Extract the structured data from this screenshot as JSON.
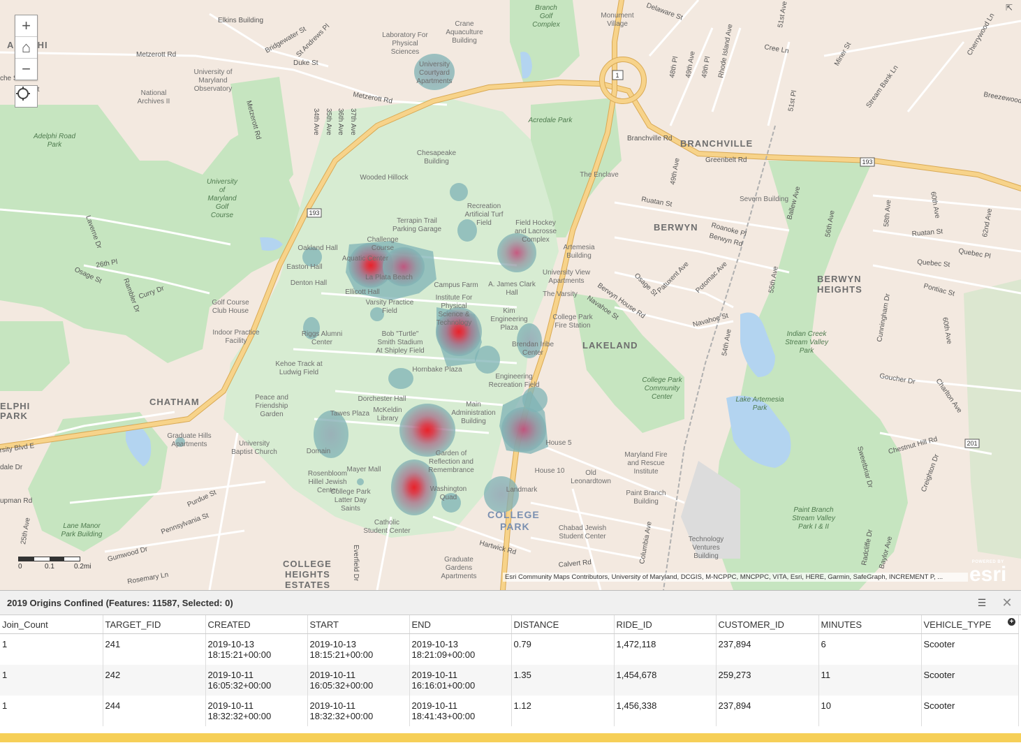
{
  "map": {
    "place_labels": {
      "adelphi_top": "ADELPHI",
      "adelphi_park": "DELPHI\nPARK",
      "chatham": "CHATHAM",
      "berwyn": "BERWYN",
      "branchville": "BRANCHVILLE",
      "lakeland": "LAKELAND",
      "berwyn_heights": "BERWYN\nHEIGHTS",
      "college_park": "COLLEGE\nPARK",
      "college_heights_estates": "COLLEGE\nHEIGHTS\nESTATES"
    },
    "road_labels": [
      "Metzerott Rd",
      "Metzerott Rd",
      "Elkins Building",
      "Bridgewater St",
      "St Andrews Pl",
      "Duke St",
      "34th Ave",
      "35th Ave",
      "36th Ave",
      "37th Ave",
      "Branchville Rd",
      "Greenbelt Rd",
      "Ruatan St",
      "Roanoke Pl",
      "Berwyn Rd",
      "Osage St",
      "Patuxent Ave",
      "Potomac Ave",
      "Navahoe St",
      "Berwyn House Rd",
      "Pontiac St",
      "Quebec St",
      "Quebec Pl",
      "Ruatan St",
      "Delaware St",
      "Cree Ln",
      "Miner St",
      "Stream Bank Ln",
      "Breezewood",
      "Cherrywood Ln",
      "Rhode Island Ave",
      "48th Pl",
      "49th Ave",
      "49th Pl",
      "51st Pl",
      "51st Ave",
      "Laverne Dr",
      "26th Pl",
      "Osage St",
      "Curry Dr",
      "Rambler Dr",
      "University Blvd E",
      "Purdue St",
      "Pennsylvania St",
      "Gumwood Dr",
      "Rosemary Ln",
      "Hartwick Rd",
      "Calvert Rd",
      "Columbia Ave",
      "Goucher Dr",
      "Chestnut Hill Rd",
      "Charlton Ave",
      "Creighton Dr",
      "Sweetbriar Dr",
      "Radcliffe Dr",
      "Baylor Ave",
      "Cunningham Dr",
      "60th Ave",
      "62nd Ave",
      "58th Ave",
      "54th Ave",
      "55th Ave",
      "56th Ave",
      "Ballew Ave",
      "Everfield Dr",
      "25th Ave",
      "Lupman Rd",
      "Adale Dr",
      "Vale Dr"
    ],
    "poi_labels": [
      "University of Maryland Observatory",
      "National Archives II",
      "Laboratory For Physical Sciences",
      "Crane Aquaculture Building",
      "University Courtyard Apartments",
      "Chesapeake Building",
      "Wooded Hillock",
      "Recreation Artificial Turf Field",
      "Terrapin Trail Parking Garage",
      "Field Hockey and Lacrosse Complex",
      "Challenge Course",
      "Aquatic Center",
      "La Plata Beach",
      "Oakland Hall",
      "Easton Hall",
      "Denton Hall",
      "Ellicott Hall",
      "Campus Farm",
      "A. James Clark Hall",
      "Institute For Physical Science & Technology",
      "Varsity Practice Field",
      "Kim Engineering Plaza",
      "Riggs Alumni Center",
      "Bob \"Turtle\" Smith Stadium At Shipley Field",
      "Brendan Iribe Center",
      "Kehoe Track at Ludwig Field",
      "Hornbake Plaza",
      "Engineering Recreation Field",
      "Dorchester Hall",
      "McKeldin Library",
      "Tawes Plaza",
      "Main Administration Building",
      "Peace and Friendship Garden",
      "Graduate Hills Apartments",
      "University Baptist Church",
      "Domain",
      "Garden of Reflection and Remembrance",
      "Mayer Mall",
      "Rosenbloom Hillel Jewish Center",
      "College Park Latter Day Saints",
      "Washington Quad",
      "Catholic Student Center",
      "Graduate Gardens Apartments",
      "Landmark",
      "House 5",
      "House 10",
      "Old Leonardtown",
      "Chabad Jewish Student Center",
      "Maryland Fire and Rescue Institute",
      "Paint Branch Building",
      "Technology Ventures Building",
      "College Park Fire Station",
      "University View Apartments",
      "The Varsity",
      "Artemesia Building",
      "The Enclave",
      "Severn Building",
      "Golf Course Club House",
      "Indoor Practice Facility",
      "Monument Village"
    ],
    "park_labels": [
      "Adelphi Road Park",
      "University of Maryland Golf Course",
      "Acredale Park",
      "Paint Branch Golf Complex",
      "College Park Community Center",
      "Indian Creek Stream Valley Park",
      "Lake Artemesia Park",
      "Paint Branch Stream Valley Park I & II",
      "Lane Manor Park Building"
    ],
    "route_shields": [
      "1",
      "193",
      "193",
      "193",
      "201"
    ],
    "heat_hotspots": [
      {
        "name": "La Plata Beach",
        "intensity": "high"
      },
      {
        "name": "Aquatic Center",
        "intensity": "high"
      },
      {
        "name": "IPST",
        "intensity": "high"
      },
      {
        "name": "McKeldin Library",
        "intensity": "high"
      },
      {
        "name": "Washington Quad",
        "intensity": "high"
      },
      {
        "name": "Field Hockey Complex",
        "intensity": "medium"
      },
      {
        "name": "Main Administration",
        "intensity": "medium"
      },
      {
        "name": "Domain",
        "intensity": "low"
      },
      {
        "name": "Landmark",
        "intensity": "low"
      },
      {
        "name": "Brendan Iribe Center",
        "intensity": "low"
      },
      {
        "name": "University Courtyard Apartments",
        "intensity": "low"
      }
    ],
    "scale": {
      "labels": [
        "0",
        "0.1",
        "0.2mi"
      ]
    },
    "attribution": "Esri Community Maps Contributors, University of Maryland, DCGIS, M-NCPPC, MNCPPC, VITA, Esri, HERE, Garmin, SafeGraph, INCREMENT P, ...",
    "logo": {
      "top": "POWERED BY",
      "brand": "esri"
    },
    "controls": {
      "zoom_in": "+",
      "home": "⌂",
      "zoom_out": "−"
    },
    "colors": {
      "park": "#c6e5c0",
      "campus": "#d7ecd2",
      "water": "#b3d4f0",
      "highway": "#f7d38a",
      "heat_low": "#7fb3b5",
      "heat_high": "#d9262f"
    }
  },
  "table": {
    "title": "2019 Origins Confined (Features: 11587, Selected: 0)",
    "columns": [
      "Join_Count",
      "TARGET_FID",
      "CREATED",
      "START",
      "END",
      "DISTANCE",
      "RIDE_ID",
      "CUSTOMER_ID",
      "MINUTES",
      "VEHICLE_TYPE"
    ],
    "rows": [
      [
        "1",
        "241",
        "2019-10-13\n18:15:21+00:00",
        "2019-10-13\n18:15:21+00:00",
        "2019-10-13\n18:21:09+00:00",
        "0.79",
        "1,472,118",
        "237,894",
        "6",
        "Scooter"
      ],
      [
        "1",
        "242",
        "2019-10-11\n16:05:32+00:00",
        "2019-10-11\n16:05:32+00:00",
        "2019-10-11\n16:16:01+00:00",
        "1.35",
        "1,454,678",
        "259,273",
        "11",
        "Scooter"
      ],
      [
        "1",
        "244",
        "2019-10-11\n18:32:32+00:00",
        "2019-10-11\n18:32:32+00:00",
        "2019-10-11\n18:41:43+00:00",
        "1.12",
        "1,456,338",
        "237,894",
        "10",
        "Scooter"
      ]
    ]
  }
}
